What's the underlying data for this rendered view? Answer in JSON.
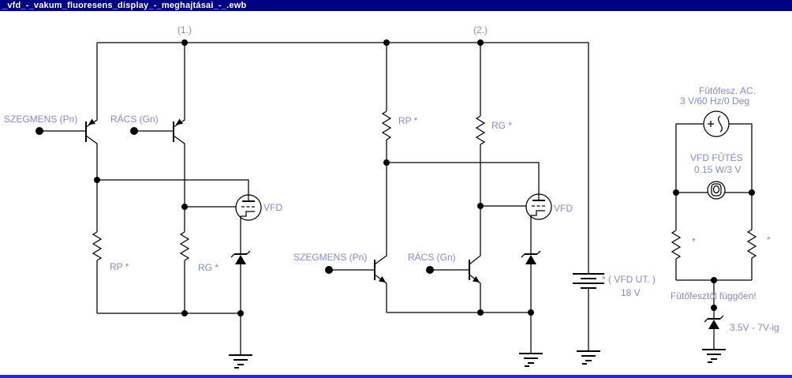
{
  "window": {
    "title": "_vfd_-_vakum_fluoresens_display_-_meghajtásai_-_.ewb"
  },
  "colors": {
    "titlebar_bg": "#000082",
    "titlebar_text": "#FFFFFF",
    "bottombar": "#2929CC",
    "canvas": "#FFFFFF",
    "wire": "#000000",
    "label": "#8888C8"
  },
  "schematic": {
    "section1": {
      "tag": "(1.)",
      "segment_input": "SZEGMENS (Pn)",
      "grid_input": "RÁCS (Gn)",
      "rp": "RP *",
      "rg": "RG *",
      "tube": "VFD"
    },
    "section2": {
      "tag": "(2.)",
      "segment_input": "SZEGMENS (Pn)",
      "grid_input": "RÁCS (Gn)",
      "rp": "RP *",
      "rg": "RG *",
      "tube": "VFD"
    },
    "supply": {
      "name": "* ( VFD UT. )",
      "voltage": "18 V"
    },
    "heater": {
      "source_name": "Fûtőfesz. AC.",
      "source_value": "3 V/60 Hz/0 Deg",
      "lamp_name": "VFD FÛTÉS",
      "lamp_value": "0.15 W/3 V",
      "r_left": "*",
      "r_right": "*",
      "note": "Fûtőfesztől függően!",
      "zener_range": "3.5V - 7V-ig"
    }
  }
}
